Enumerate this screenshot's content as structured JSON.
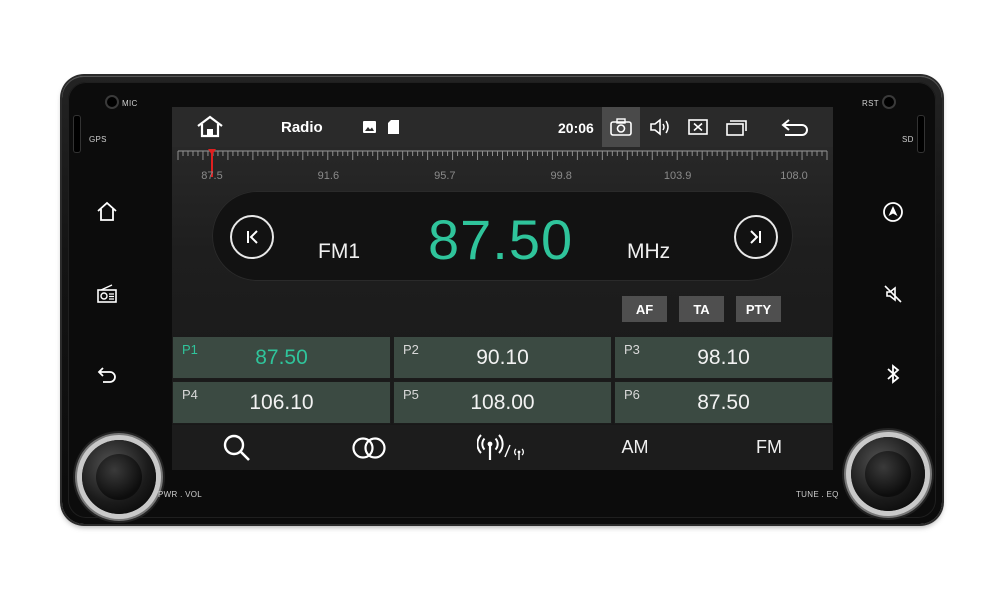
{
  "device": {
    "labels": {
      "mic": "MIC",
      "gps": "GPS",
      "rst": "RST",
      "sd": "SD",
      "pwr_vol": "PWR . VOL",
      "tune_eq": "TUNE . EQ"
    },
    "left_buttons": [
      {
        "icon": "home-icon"
      },
      {
        "icon": "radio-icon"
      },
      {
        "icon": "back-icon"
      }
    ],
    "right_buttons": [
      {
        "icon": "navigation-icon"
      },
      {
        "icon": "mute-icon"
      },
      {
        "icon": "bluetooth-icon"
      }
    ]
  },
  "status_bar": {
    "title": "Radio",
    "time": "20:06",
    "icons": [
      "home-icon",
      "image-icon",
      "sd-card-icon",
      "screenshot-icon",
      "volume-icon",
      "close-icon",
      "recent-apps-icon",
      "back-icon"
    ]
  },
  "tuner": {
    "scale_labels": [
      "87.5",
      "91.6",
      "95.7",
      "99.8",
      "103.9",
      "108.0"
    ],
    "scale_min": 87.5,
    "scale_max": 108.0,
    "needle_value": 87.5,
    "band": "FM1",
    "frequency": "87.50",
    "unit": "MHz"
  },
  "rds_buttons": [
    "AF",
    "TA",
    "PTY"
  ],
  "presets": [
    {
      "name": "P1",
      "value": "87.50",
      "active": true
    },
    {
      "name": "P2",
      "value": "90.10",
      "active": false
    },
    {
      "name": "P3",
      "value": "98.10",
      "active": false
    },
    {
      "name": "P4",
      "value": "106.10",
      "active": false
    },
    {
      "name": "P5",
      "value": "108.00",
      "active": false
    },
    {
      "name": "P6",
      "value": "87.50",
      "active": false
    }
  ],
  "bottom_bar": {
    "items": [
      {
        "icon": "search-icon"
      },
      {
        "icon": "stereo-icon"
      },
      {
        "icon": "broadcast-icon"
      },
      {
        "label": "AM"
      },
      {
        "label": "FM"
      }
    ]
  },
  "colors": {
    "accent": "#2fc49b",
    "preset_bg": "#3b4a42",
    "needle": "#e02020"
  }
}
